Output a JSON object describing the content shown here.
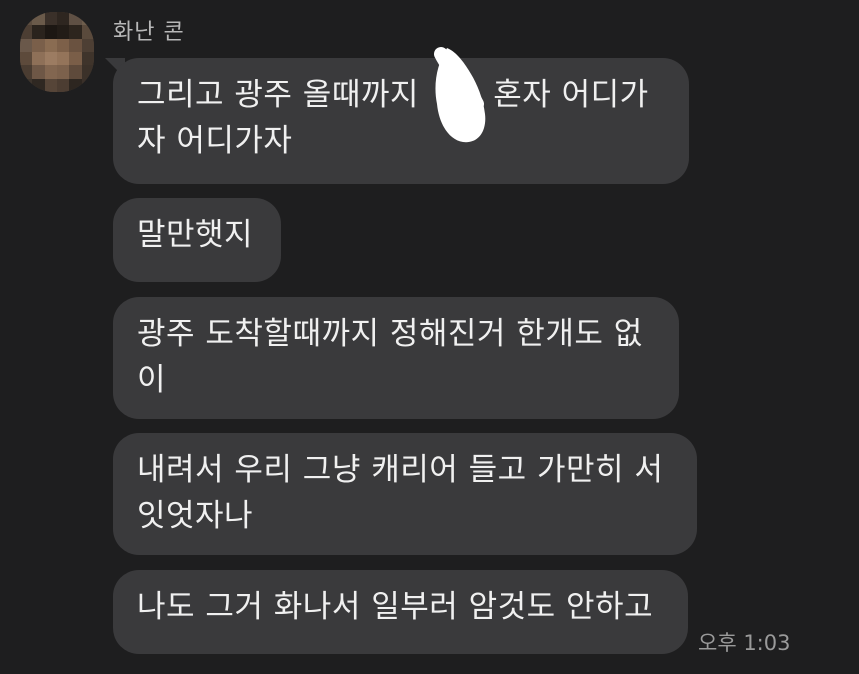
{
  "chat": {
    "sender": {
      "name": "화난 콘",
      "avatar_icon": "blurred-profile-photo"
    },
    "messages": [
      {
        "lines": [
          "그리고 광주 올때까지 ",
          "자 어디가자"
        ],
        "line1_tail": "혼자 어디가"
      },
      {
        "lines": [
          "말만햇지"
        ]
      },
      {
        "lines": [
          "광주 도착할때까지 정해진거 한개도 없",
          "이"
        ]
      },
      {
        "lines": [
          "내려서 우리 그냥 캐리어 들고 가만히 서",
          "잇엇자나"
        ]
      },
      {
        "lines": [
          "나도 그거 화나서 일부러 암것도 안하고"
        ]
      }
    ],
    "timestamp": "오후 1:03"
  },
  "theme": {
    "background": "#1e1e1f",
    "bubble": "#3a3a3c",
    "text": "#f0f0f0",
    "name_text": "#b8b8b8",
    "time_text": "#9a9a9a",
    "censor_mark": "#ffffff"
  }
}
